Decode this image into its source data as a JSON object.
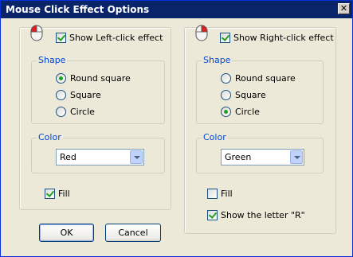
{
  "window": {
    "title": "Mouse Click Effect Options",
    "close_glyph": "✕"
  },
  "left": {
    "show_label": "Show Left-click effect",
    "show_checked": true,
    "shape_legend": "Shape",
    "shapes": [
      {
        "label": "Round square",
        "selected": true
      },
      {
        "label": "Square",
        "selected": false
      },
      {
        "label": "Circle",
        "selected": false
      }
    ],
    "color_legend": "Color",
    "color_value": "Red",
    "fill_label": "Fill",
    "fill_checked": true
  },
  "right": {
    "show_label": "Show Right-click effect",
    "show_checked": true,
    "shape_legend": "Shape",
    "shapes": [
      {
        "label": "Round square",
        "selected": false
      },
      {
        "label": "Square",
        "selected": false
      },
      {
        "label": "Circle",
        "selected": true
      }
    ],
    "color_legend": "Color",
    "color_value": "Green",
    "fill_label": "Fill",
    "fill_checked": false,
    "letter_label": "Show the letter \"R\"",
    "letter_checked": true
  },
  "buttons": {
    "ok": "OK",
    "cancel": "Cancel"
  },
  "icons": {
    "left_mouse": "mouse-left-button-icon",
    "right_mouse": "mouse-right-button-icon"
  },
  "colors": {
    "titlebar": "#0a246a",
    "legend": "#0046d5",
    "check": "#21a121",
    "dialog_bg": "#ece9d8"
  }
}
